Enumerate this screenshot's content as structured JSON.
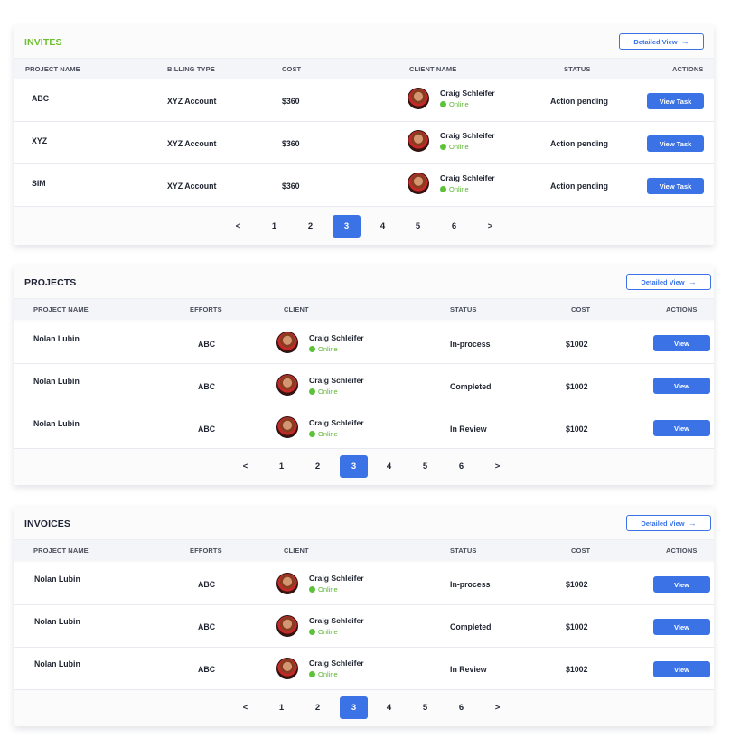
{
  "invites": {
    "title": "INVITES",
    "detail_label": "Detailed View",
    "columns": [
      "PROJECT NAME",
      "BILLING TYPE",
      "COST",
      "CLIENT NAME",
      "STATUS",
      "ACTIONS"
    ],
    "rows": [
      {
        "project": "ABC",
        "billing": "XYZ Account",
        "cost": "$360",
        "client": "Craig Schleifer",
        "presence": "Online",
        "status": "Action pending",
        "action": "View Task"
      },
      {
        "project": "XYZ",
        "billing": "XYZ Account",
        "cost": "$360",
        "client": "Craig Schleifer",
        "presence": "Online",
        "status": "Action pending",
        "action": "View Task"
      },
      {
        "project": "SIM",
        "billing": "XYZ Account",
        "cost": "$360",
        "client": "Craig Schleifer",
        "presence": "Online",
        "status": "Action pending",
        "action": "View Task"
      }
    ],
    "pagination": {
      "prev": "<",
      "next": ">",
      "pages": [
        "1",
        "2",
        "3",
        "4",
        "5",
        "6"
      ],
      "current": "3"
    }
  },
  "projects": {
    "title": "PROJECTS",
    "detail_label": "Detailed View",
    "columns": [
      "PROJECT NAME",
      "EFFORTS",
      "CLIENT",
      "STATUS",
      "COST",
      "ACTIONS"
    ],
    "rows": [
      {
        "project": "Nolan Lubin",
        "efforts": "ABC",
        "client": "Craig Schleifer",
        "presence": "Online",
        "status": "In-process",
        "cost": "$1002",
        "action": "View"
      },
      {
        "project": "Nolan Lubin",
        "efforts": "ABC",
        "client": "Craig Schleifer",
        "presence": "Online",
        "status": "Completed",
        "cost": "$1002",
        "action": "View"
      },
      {
        "project": "Nolan Lubin",
        "efforts": "ABC",
        "client": "Craig Schleifer",
        "presence": "Online",
        "status": "In Review",
        "cost": "$1002",
        "action": "View"
      }
    ],
    "pagination": {
      "prev": "<",
      "next": ">",
      "pages": [
        "1",
        "2",
        "3",
        "4",
        "5",
        "6"
      ],
      "current": "3"
    }
  },
  "invoices": {
    "title": "INVOICES",
    "detail_label": "Detailed View",
    "columns": [
      "PROJECT NAME",
      "EFFORTS",
      "CLIENT",
      "STATUS",
      "COST",
      "ACTIONS"
    ],
    "rows": [
      {
        "project": "Nolan Lubin",
        "efforts": "ABC",
        "client": "Craig Schleifer",
        "presence": "Online",
        "status": "In-process",
        "cost": "$1002",
        "action": "View"
      },
      {
        "project": "Nolan Lubin",
        "efforts": "ABC",
        "client": "Craig Schleifer",
        "presence": "Online",
        "status": "Completed",
        "cost": "$1002",
        "action": "View"
      },
      {
        "project": "Nolan Lubin",
        "efforts": "ABC",
        "client": "Craig Schleifer",
        "presence": "Online",
        "status": "In Review",
        "cost": "$1002",
        "action": "View"
      }
    ],
    "pagination": {
      "prev": "<",
      "next": ">",
      "pages": [
        "1",
        "2",
        "3",
        "4",
        "5",
        "6"
      ],
      "current": "3"
    }
  },
  "colors": {
    "accent": "#3b73e6",
    "invites_title": "#6cbf2e",
    "online": "#5cc23a"
  },
  "icons": {
    "detail_arrow": "arrow-right-icon",
    "presence": "online-dot-icon",
    "prev": "chevron-left-icon",
    "next": "chevron-right-icon"
  }
}
